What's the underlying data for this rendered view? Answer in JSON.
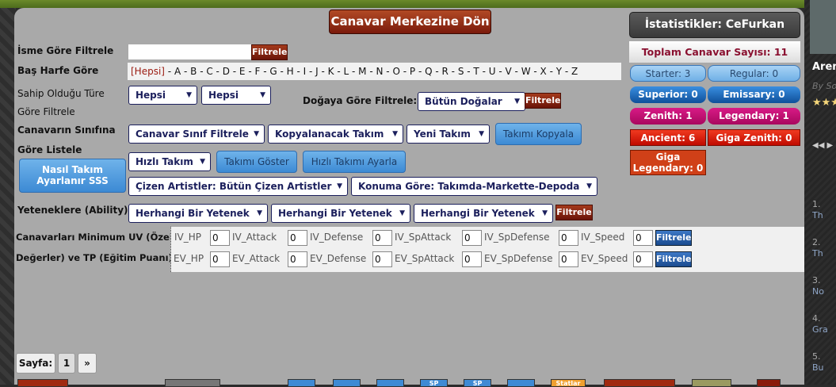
{
  "header": {
    "back_button": "Canavar Merkezine Dön"
  },
  "filters": {
    "name_label": "İsme Göre Filtrele",
    "name_value": "",
    "filter_btn": "Filtrele",
    "letter_label": "Baş Harfe Göre",
    "letter_all": "[Hepsi]",
    "letters": [
      "A",
      "B",
      "C",
      "D",
      "E",
      "F",
      "G",
      "H",
      "I",
      "J",
      "K",
      "L",
      "M",
      "N",
      "O",
      "P",
      "Q",
      "R",
      "S",
      "T",
      "U",
      "V",
      "W",
      "X",
      "Y",
      "Z"
    ],
    "type_label1": "Sahip Olduğu Türe",
    "type_label2": "Göre Filtrele",
    "type_select1": "Hepsi",
    "type_select2": "Hepsi",
    "nature_label": "Doğaya Göre Filtrele:",
    "nature_select": "Bütün Doğalar",
    "class_label1": "Canavarın Sınıfına",
    "class_label2": "Göre Listele",
    "class_select": "Canavar Sınıf Filtrele",
    "copy_team_select": "Kopyalanacak Takım",
    "new_team_select": "Yeni Takım",
    "copy_team_btn": "Takımı Kopyala",
    "quick_team_select": "Hızlı Takım",
    "show_team_btn": "Takımı Göster",
    "set_quick_team_btn": "Hızlı Takımı Ayarla",
    "faq_btn": "Nasıl Takım Ayarlanır SSS",
    "artist_select": "Çizen Artistler: Bütün Çizen Artistler",
    "location_select": "Konuma Göre: Takımda-Markette-Depoda",
    "ability_label": "Yeteneklere (Ability)",
    "ability_selects": [
      "Herhangi Bir Yetenek",
      "Herhangi Bir Yetenek",
      "Herhangi Bir Yetenek"
    ],
    "stats_label1": "Canavarları Minimum UV (Özel",
    "stats_label2": "Değerler) ve TP (Eğitim Puanı)",
    "iv": [
      {
        "label": "IV_HP",
        "value": "0"
      },
      {
        "label": "IV_Attack",
        "value": "0"
      },
      {
        "label": "IV_Defense",
        "value": "0"
      },
      {
        "label": "IV_SpAttack",
        "value": "0"
      },
      {
        "label": "IV_SpDefense",
        "value": "0"
      },
      {
        "label": "IV_Speed",
        "value": "0"
      }
    ],
    "ev": [
      {
        "label": "EV_HP",
        "value": "0"
      },
      {
        "label": "EV_Attack",
        "value": "0"
      },
      {
        "label": "EV_Defense",
        "value": "0"
      },
      {
        "label": "EV_SpAttack",
        "value": "0"
      },
      {
        "label": "EV_SpDefense",
        "value": "0"
      },
      {
        "label": "EV_Speed",
        "value": "0"
      }
    ]
  },
  "pagination": {
    "label": "Sayfa:",
    "current": "1",
    "next": "»"
  },
  "stats": {
    "title": "İstatistikler: CeFurkan",
    "total": "Toplam Canavar Sayısı: 11",
    "items": [
      "Starter: 3",
      "Regular: 0",
      "Superior: 0",
      "Emissary: 0",
      "Zenith: 1",
      "Legendary: 1",
      "Ancient: 6",
      "Giga Zenith: 0",
      "Giga Legendary: 0"
    ]
  },
  "bottom": {
    "sp1": "SP",
    "sp2": "SP",
    "statlar": "Statlar"
  },
  "sidebar": {
    "title": "Aren",
    "by": "By So",
    "stars": "★★★",
    "items": [
      "1.",
      "Th",
      "2.",
      "Th",
      "3.",
      "No",
      "4.",
      "Gra",
      "5.",
      "Bu"
    ]
  }
}
